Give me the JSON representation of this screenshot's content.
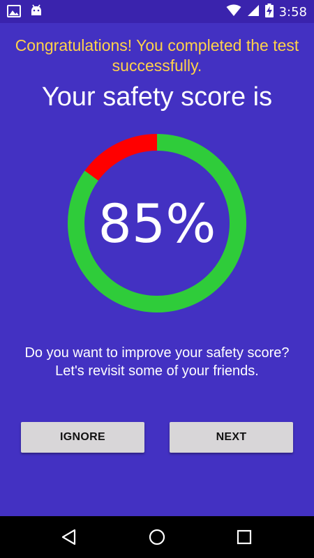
{
  "status_bar": {
    "time": "3:58",
    "left_icons": [
      "image-icon",
      "android-icon"
    ],
    "right_icons": [
      "wifi-icon",
      "signal-icon",
      "battery-charging-icon"
    ]
  },
  "screen": {
    "congrats_text": "Congratulations! You completed the test successfully.",
    "heading": "Your safety score is",
    "score_text": "85%",
    "score_value": 85,
    "prompt_line1": "Do you want to improve your safety score?",
    "prompt_line2": "Let's revisit some of your friends."
  },
  "buttons": {
    "ignore_label": "IGNORE",
    "next_label": "NEXT"
  },
  "colors": {
    "background": "#4331c2",
    "status_bar": "#3a23ad",
    "congrats": "#ffd24a",
    "gauge_safe": "#2fcc3a",
    "gauge_risk": "#ff0000",
    "button": "#d8d6d8"
  },
  "nav_bar": {
    "icons": [
      "back-icon",
      "home-icon",
      "recents-icon"
    ]
  }
}
